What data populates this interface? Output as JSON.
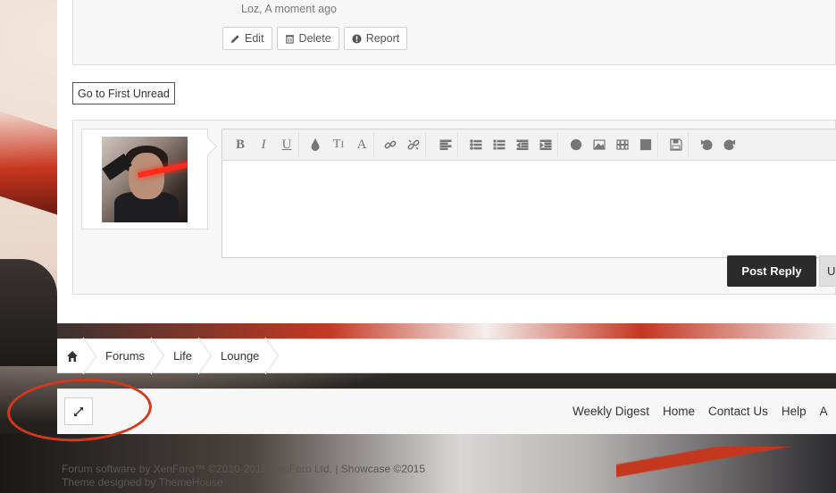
{
  "post": {
    "meta": "Loz, A moment ago",
    "actions": {
      "edit": "Edit",
      "delete": "Delete",
      "report": "Report"
    }
  },
  "first_unread_label": "Go to First Unread",
  "editor": {
    "toolbar_icons": [
      "bold",
      "italic",
      "underline",
      "text-color",
      "font-size",
      "font-face",
      "link",
      "unlink",
      "align",
      "bullet-list",
      "numbered-list",
      "outdent",
      "indent",
      "smilie",
      "image",
      "media",
      "insert",
      "save-draft",
      "undo",
      "redo"
    ]
  },
  "reply": {
    "post_reply_label": "Post Reply",
    "upload_label": "U"
  },
  "breadcrumb": {
    "items": [
      "Forums",
      "Life",
      "Lounge"
    ]
  },
  "footer": {
    "links": [
      "Weekly Digest",
      "Home",
      "Contact Us",
      "Help",
      "A"
    ]
  },
  "copyright": {
    "line1": "Forum software by XenForo™ ©2010-2015 XenForo Ltd. | Showcase ©2015",
    "line2": "Theme designed by ThemeHouse"
  },
  "colors": {
    "accent_ring": "#d4381c",
    "primary_button": "#2b2b2b"
  }
}
